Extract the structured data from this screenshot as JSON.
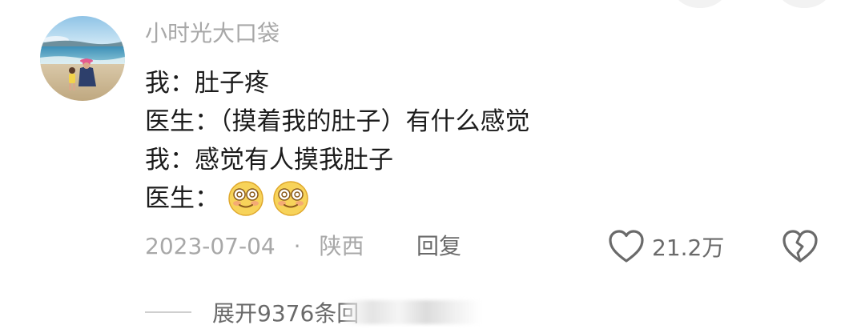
{
  "comment": {
    "username": "小时光大口袋",
    "lines": [
      "我：肚子疼",
      "医生：（摸着我的肚子）有什么感觉",
      "我：感觉有人摸我肚子",
      "医生："
    ],
    "emoji_icons": [
      "blushing-face-emoji",
      "blushing-face-emoji"
    ],
    "date": "2023-07-04",
    "separator": "·",
    "location": "陕西",
    "reply_label": "回复",
    "like_count": "21.2万",
    "expand_label": "展开9376条回"
  },
  "colors": {
    "meta_text": "#a8a8a8",
    "action_text": "#6a6a6a",
    "body_text": "#1c1c1c"
  }
}
